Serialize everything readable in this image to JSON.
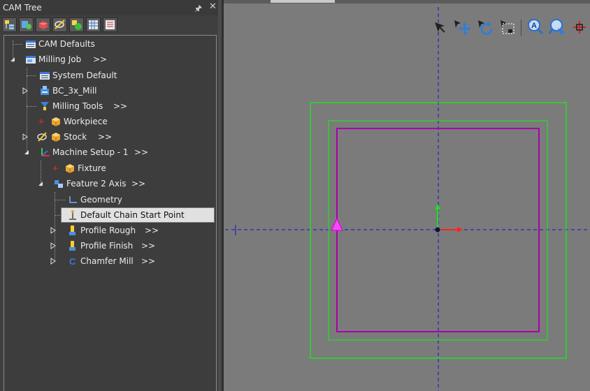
{
  "panel": {
    "title": "CAM Tree",
    "pin_icon": "pin-icon",
    "close_icon": "close-icon",
    "toolbar_icons": [
      "tree-view-icon",
      "tool-library-icon",
      "stock-icon",
      "toolpath-toggle-icon",
      "simulate-icon",
      "grid-view-icon",
      "properties-icon"
    ]
  },
  "tree": {
    "cam_defaults": "CAM Defaults",
    "milling_job": "Milling Job",
    "system_default": "System Default",
    "bc_mill": "BC_3x_Mill",
    "milling_tools": "Milling Tools",
    "workpiece": "Workpiece",
    "stock": "Stock",
    "machine_setup": "Machine Setup - 1",
    "fixture": "Fixture",
    "feature": "Feature 2 Axis",
    "geometry": "Geometry",
    "chain_start": "Default Chain Start Point",
    "profile_rough": "Profile Rough",
    "profile_finish": "Profile Finish",
    "chamfer_mill": "Chamfer Mill",
    "more": ">>"
  },
  "viewport": {
    "toolbar_icons": [
      "select-icon",
      "pan-icon",
      "rotate-icon",
      "zoom-window-icon",
      "zoom-icon",
      "zoom-fit-icon",
      "axis-icon"
    ],
    "colors": {
      "background": "#7b7b7b",
      "stock_boundary": "#22e022",
      "chain_profile": "#a800a8",
      "axis_line": "#0000cc",
      "start_marker": "#ff44ff",
      "x_axis": "#ff2222",
      "y_axis": "#22dd22"
    }
  }
}
